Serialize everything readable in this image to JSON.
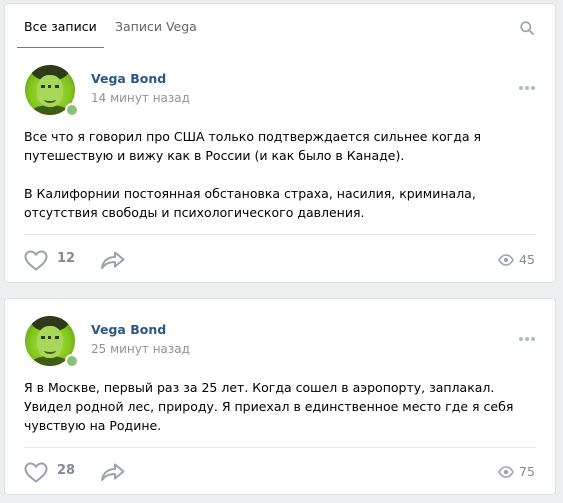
{
  "tabs": {
    "all_posts": "Все записи",
    "user_posts": "Записи Vega"
  },
  "icons": {
    "search": "search-icon",
    "more": "more-icon",
    "like": "heart-icon",
    "share": "share-icon",
    "views": "eye-icon"
  },
  "colors": {
    "accent": "#5181b8",
    "author": "#2a5885",
    "online": "#8ac176",
    "muted": "#828a99"
  },
  "posts": [
    {
      "author": "Vega Bond",
      "time": "14 минут назад",
      "paragraphs": [
        "Все что я говорил про США только подтверждается сильнее когда я путешествую и вижу как в России (и как было в Канаде).",
        "В Калифорнии постоянная обстановка страха, насилия, криминала, отсутствия свободы и психологического давления."
      ],
      "likes": "12",
      "views": "45"
    },
    {
      "author": "Vega Bond",
      "time": "25 минут назад",
      "paragraphs": [
        "Я в Москве, первый раз за 25 лет. Когда сошел в аэропорту, заплакал. Увидел родной лес, природу. Я приехал в единственное место где я себя чувствую на Родине."
      ],
      "likes": "28",
      "views": "75"
    }
  ]
}
